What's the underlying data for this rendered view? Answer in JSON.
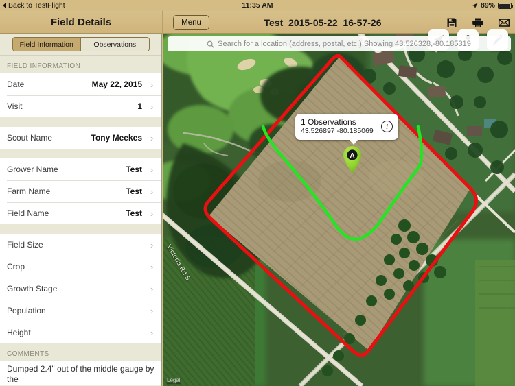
{
  "statusbar": {
    "back_label": "Back to TestFlight",
    "time": "11:35 AM",
    "battery_percent": "89%",
    "location_icon": "location-arrow-icon",
    "battery_icon": "battery-icon"
  },
  "navbar": {
    "left_title": "Field Details",
    "menu_label": "Menu",
    "title": "Test_2015-05-22_16-57-26",
    "icons": [
      {
        "name": "save-icon",
        "label": "Save"
      },
      {
        "name": "print-icon",
        "label": "Print"
      },
      {
        "name": "mail-icon",
        "label": "Mail"
      }
    ]
  },
  "sidebar": {
    "tabs": [
      {
        "label": "Field Information",
        "active": true
      },
      {
        "label": "Observations",
        "active": false
      }
    ],
    "section_title": "FIELD INFORMATION",
    "group1": [
      {
        "label": "Date",
        "value": "May 22, 2015"
      },
      {
        "label": "Visit",
        "value": "1"
      }
    ],
    "group2": [
      {
        "label": "Scout Name",
        "value": "Tony Meekes"
      }
    ],
    "group3": [
      {
        "label": "Grower Name",
        "value": "Test"
      },
      {
        "label": "Farm Name",
        "value": "Test"
      },
      {
        "label": "Field Name",
        "value": "Test"
      }
    ],
    "group4": [
      {
        "label": "Field Size",
        "value": ""
      },
      {
        "label": "Crop",
        "value": ""
      },
      {
        "label": "Growth Stage",
        "value": ""
      },
      {
        "label": "Population",
        "value": ""
      },
      {
        "label": "Height",
        "value": ""
      }
    ],
    "comments_title": "COMMENTS",
    "comments_text": "Dumped 2.4\" out of the middle gauge by the",
    "chevron": "›"
  },
  "map": {
    "search_placeholder": "Search for a location (address, postal, etc.) Showing 43.526328,-80.185319",
    "search_icon": "search-icon",
    "buttons": [
      {
        "name": "locate-me-button",
        "icon": "navigation-arrow-icon"
      },
      {
        "name": "drop-pin-button",
        "icon": "map-pin-icon"
      },
      {
        "name": "draw-button",
        "icon": "pencil-icon"
      }
    ],
    "callout": {
      "title": "1 Observations",
      "coords": "43.526897 -80.185069",
      "info_label": "i"
    },
    "marker_label": "A",
    "road_label": "Victoria Rd S",
    "legal_label": "Legal",
    "colors": {
      "boundary": "#e81010",
      "track": "#24e424",
      "marker": "#8cd42a"
    }
  }
}
